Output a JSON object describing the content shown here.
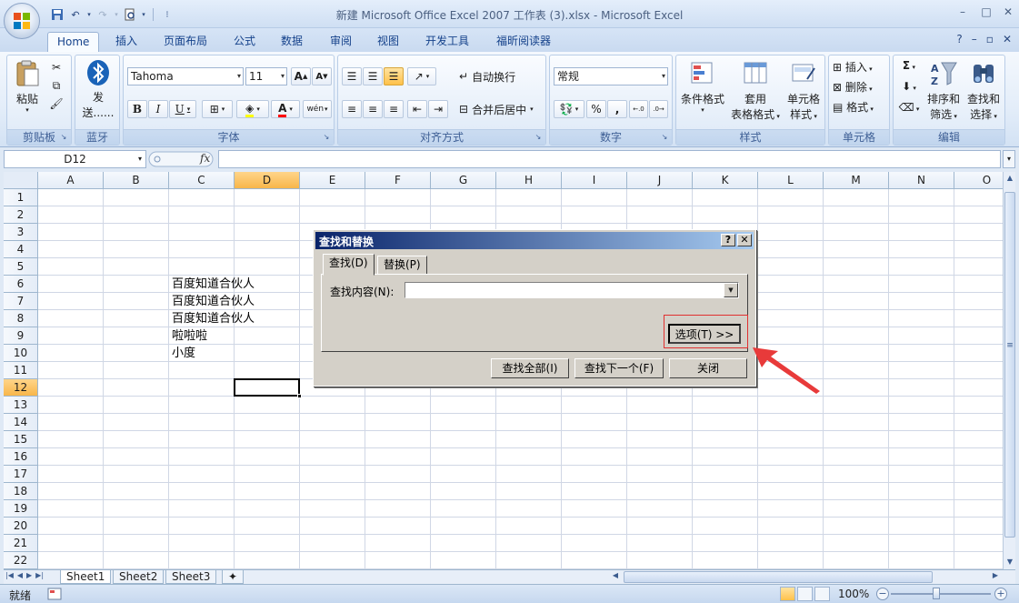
{
  "window": {
    "title": "新建 Microsoft Office Excel 2007 工作表 (3).xlsx - Microsoft Excel",
    "minimize": "–",
    "maximize": "□",
    "close": "✕"
  },
  "tabs": [
    "Home",
    "插入",
    "页面布局",
    "公式",
    "数据",
    "审阅",
    "视图",
    "开发工具",
    "福昕阅读器"
  ],
  "ribbon": {
    "clipboard": {
      "paste": "粘贴",
      "label": "剪贴板"
    },
    "bluetooth": {
      "send_line1": "发",
      "send_line2": "送......",
      "label": "蓝牙"
    },
    "font": {
      "name": "Tahoma",
      "size": "11",
      "bold": "B",
      "italic": "I",
      "underline": "U",
      "grow": "A",
      "shrink": "A",
      "phonetic": "wén",
      "label": "字体"
    },
    "alignment": {
      "wrap": "自动换行",
      "merge": "合并后居中",
      "label": "对齐方式"
    },
    "number": {
      "format": "常规",
      "percent": "%",
      "comma": ",",
      "label": "数字"
    },
    "styles": {
      "conditional_1": "条件格式",
      "table_1": "套用",
      "table_2": "表格格式",
      "cell_1": "单元格",
      "cell_2": "样式",
      "label": "样式"
    },
    "cells": {
      "insert": "插入",
      "delete": "删除",
      "format": "格式",
      "label": "单元格"
    },
    "editing": {
      "sort_1": "排序和",
      "sort_2": "筛选",
      "find_1": "查找和",
      "find_2": "选择",
      "label": "编辑"
    }
  },
  "formula_bar": {
    "name_box": "D12",
    "fx": "fx",
    "value": ""
  },
  "sheet": {
    "columns": [
      "A",
      "B",
      "C",
      "D",
      "E",
      "F",
      "G",
      "H",
      "I",
      "J",
      "K",
      "L",
      "M",
      "N",
      "O"
    ],
    "rows": [
      "1",
      "2",
      "3",
      "4",
      "5",
      "6",
      "7",
      "8",
      "9",
      "10",
      "11",
      "12",
      "13",
      "14",
      "15",
      "16",
      "17",
      "18",
      "19",
      "20",
      "21",
      "22"
    ],
    "selected_cell": "D12",
    "cells": [
      {
        "ref": "C6",
        "value": "百度知道合伙人"
      },
      {
        "ref": "C7",
        "value": "百度知道合伙人"
      },
      {
        "ref": "C8",
        "value": "百度知道合伙人"
      },
      {
        "ref": "C9",
        "value": "啦啦啦"
      },
      {
        "ref": "C10",
        "value": "小度"
      }
    ]
  },
  "sheet_tabs": [
    "Sheet1",
    "Sheet2",
    "Sheet3"
  ],
  "status": {
    "ready": "就绪",
    "zoom": "100%",
    "zoom_out": "−",
    "zoom_in": "+"
  },
  "dialog": {
    "title": "查找和替换",
    "help": "?",
    "close": "✕",
    "tabs": [
      "查找(D)",
      "替换(P)"
    ],
    "find_label": "查找内容(N):",
    "find_value": "",
    "options_button": "选项(T) >>",
    "find_all_button": "查找全部(I)",
    "find_next_button": "查找下一个(F)",
    "close_button": "关闭"
  },
  "colors": {
    "annotation": "#e03030",
    "title_bar": "#0a246a",
    "selected_header": "#f8b64a"
  }
}
